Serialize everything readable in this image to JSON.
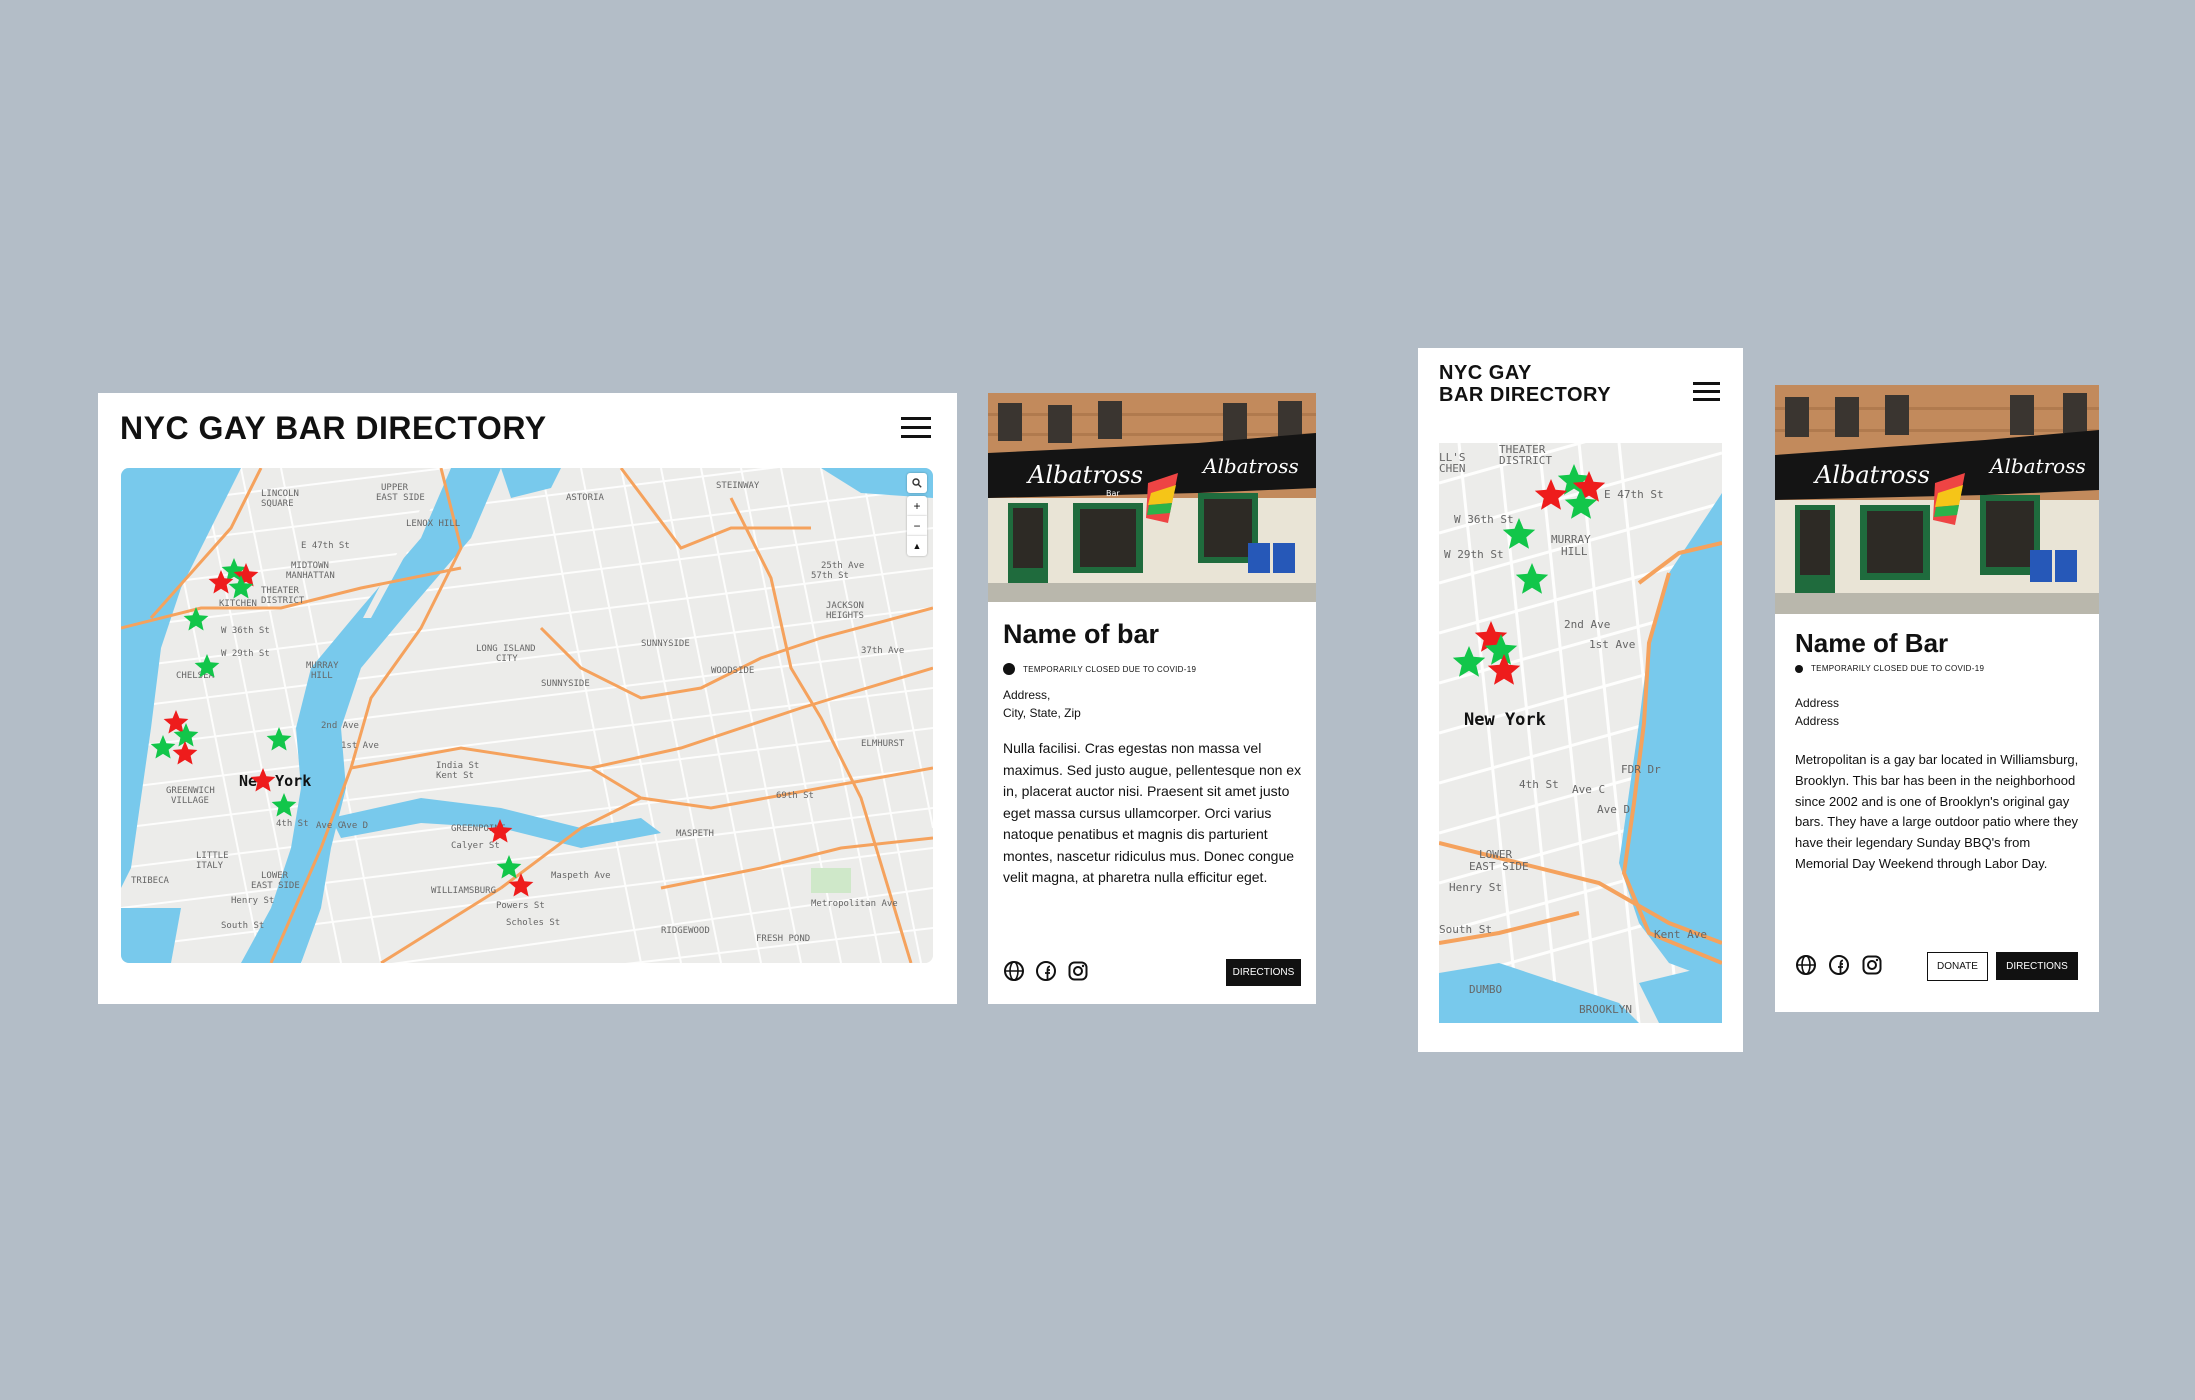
{
  "desktop": {
    "title": "NYC GAY BAR DIRECTORY",
    "map_labels": [
      "LINCOLN SQUARE",
      "UPPER EAST SIDE",
      "ASTORIA",
      "STEINWAY",
      "MIDTOWN MANHATTAN",
      "THEATER DISTRICT",
      "KITCHEN",
      "LENOX HILL",
      "LONG ISLAND CITY",
      "SUNNYSIDE",
      "WOODSIDE",
      "JACKSON HEIGHTS",
      "MURRAY HILL",
      "CHELSEA",
      "GREENWICH VILLAGE",
      "LITTLE ITALY",
      "LOWER EAST SIDE",
      "WILLIAMSBURG",
      "GREENPOINT",
      "MASPETH",
      "RIDGEWOOD",
      "FRESH POND",
      "ELMHURST",
      "TRIBECA",
      "Metropolitan Ave",
      "Henry St",
      "South St",
      "Powers St",
      "Scholes St",
      "Maspeth Ave",
      "Kent St",
      "India St",
      "Calyer St",
      "W 36th St",
      "W 29th St",
      "E 47th St",
      "2nd Ave",
      "1st Ave",
      "Ave C",
      "Ave D",
      "4th St",
      "57th St",
      "37th Ave",
      "25th Ave",
      "69th St"
    ],
    "city_label": "New York",
    "controls": {
      "search": "search-icon",
      "zoom_in": "+",
      "zoom_out": "−",
      "compass": "▲"
    }
  },
  "detail_desktop": {
    "name": "Name of bar",
    "status": "TEMPORARILY CLOSED DUE TO COVID-19",
    "address_line1": "Address,",
    "address_line2": "City, State, Zip",
    "description": "Nulla facilisi. Cras egestas non massa vel maximus. Sed justo augue, pellentesque non ex in, placerat auctor nisi. Praesent sit amet justo eget massa cursus ullamcorper. Orci varius natoque penatibus et magnis dis parturient montes, nascetur ridiculus mus. Donec congue velit magna, at pharetra nulla efficitur eget.",
    "directions_label": "DIRECTIONS",
    "sign_text_1": "Albatross",
    "sign_text_2": "Albatross",
    "sign_text_3": "Bar"
  },
  "mobile": {
    "title_line1": "NYC GAY",
    "title_line2": "BAR DIRECTORY",
    "map_labels": [
      "THEATER DISTRICT",
      "MURRAY HILL",
      "LOWER EAST SIDE",
      "DUMBO",
      "BROOKLYN",
      "LL'S CHEN",
      "W 36th St",
      "W 29th St",
      "E 47th St",
      "2nd Ave",
      "1st Ave",
      "Ave C",
      "Ave D",
      "FDR Dr",
      "Kent Ave",
      "Henry St",
      "South St",
      "4th St"
    ],
    "city_label": "New York"
  },
  "detail_mobile": {
    "name": "Name of Bar",
    "status": "TEMPORARILY CLOSED DUE TO COVID-19",
    "address_line1": "Address",
    "address_line2": "Address",
    "description": "Metropolitan is a gay bar located in Williamsburg, Brooklyn. This bar has been in the neighborhood since 2002 and is one of Brooklyn's original gay bars. They have a large outdoor patio where they have their legendary Sunday BBQ's from Memorial Day Weekend through Labor Day.",
    "donate_label": "DONATE",
    "directions_label": "DIRECTIONS",
    "sign_text_1": "Albatross",
    "sign_text_2": "Albatross"
  },
  "colors": {
    "background": "#b3bdc7",
    "water": "#78c9ec",
    "land": "#ececea",
    "highway": "#f5a25d",
    "star_open": "#12c64a",
    "star_closed": "#ee1c1c"
  },
  "icons": [
    "globe-icon",
    "facebook-icon",
    "instagram-icon",
    "menu-icon",
    "search-icon"
  ]
}
